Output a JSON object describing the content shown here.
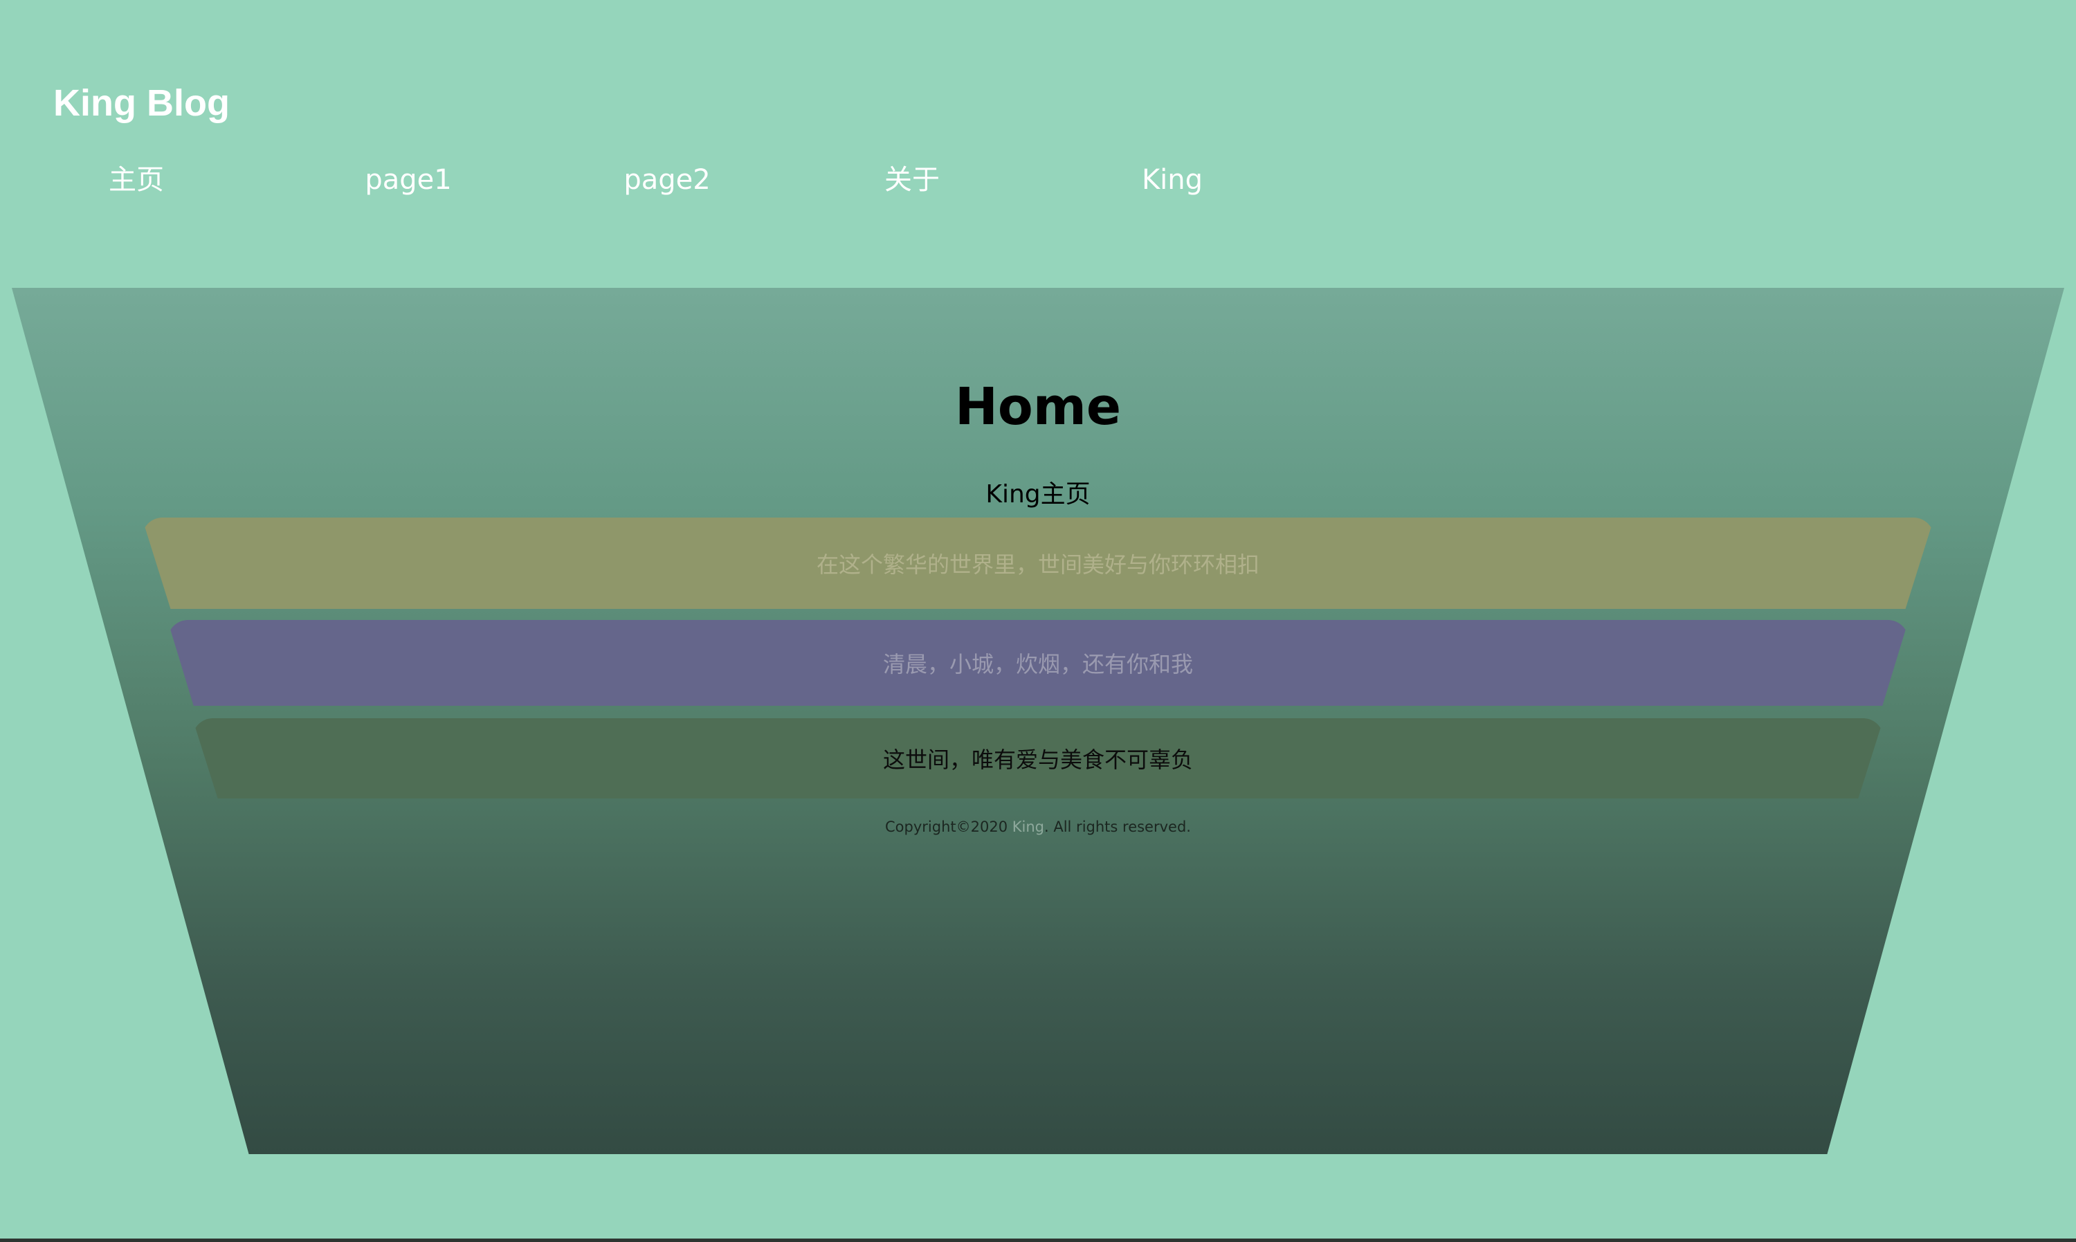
{
  "site": {
    "title": "King Blog"
  },
  "nav": {
    "items": [
      {
        "label": "主页"
      },
      {
        "label": "page1"
      },
      {
        "label": "page2"
      },
      {
        "label": "关于"
      },
      {
        "label": "King"
      }
    ]
  },
  "main": {
    "title": "Home",
    "subtitle": "King主页",
    "cards": [
      {
        "text": "在这个繁华的世界里，世间美好与你环环相扣"
      },
      {
        "text": "清晨，小城，炊烟，还有你和我"
      },
      {
        "text": "这世间，唯有爱与美食不可辜负"
      }
    ]
  },
  "footer": {
    "copyright_prefix": "Copyright©2020 ",
    "author": "King",
    "copyright_suffix": ". All rights reserved."
  },
  "colors": {
    "background": "#95d5bb",
    "card1": "#8f976a",
    "card2": "#65668b",
    "card3": "#4f6e55"
  }
}
